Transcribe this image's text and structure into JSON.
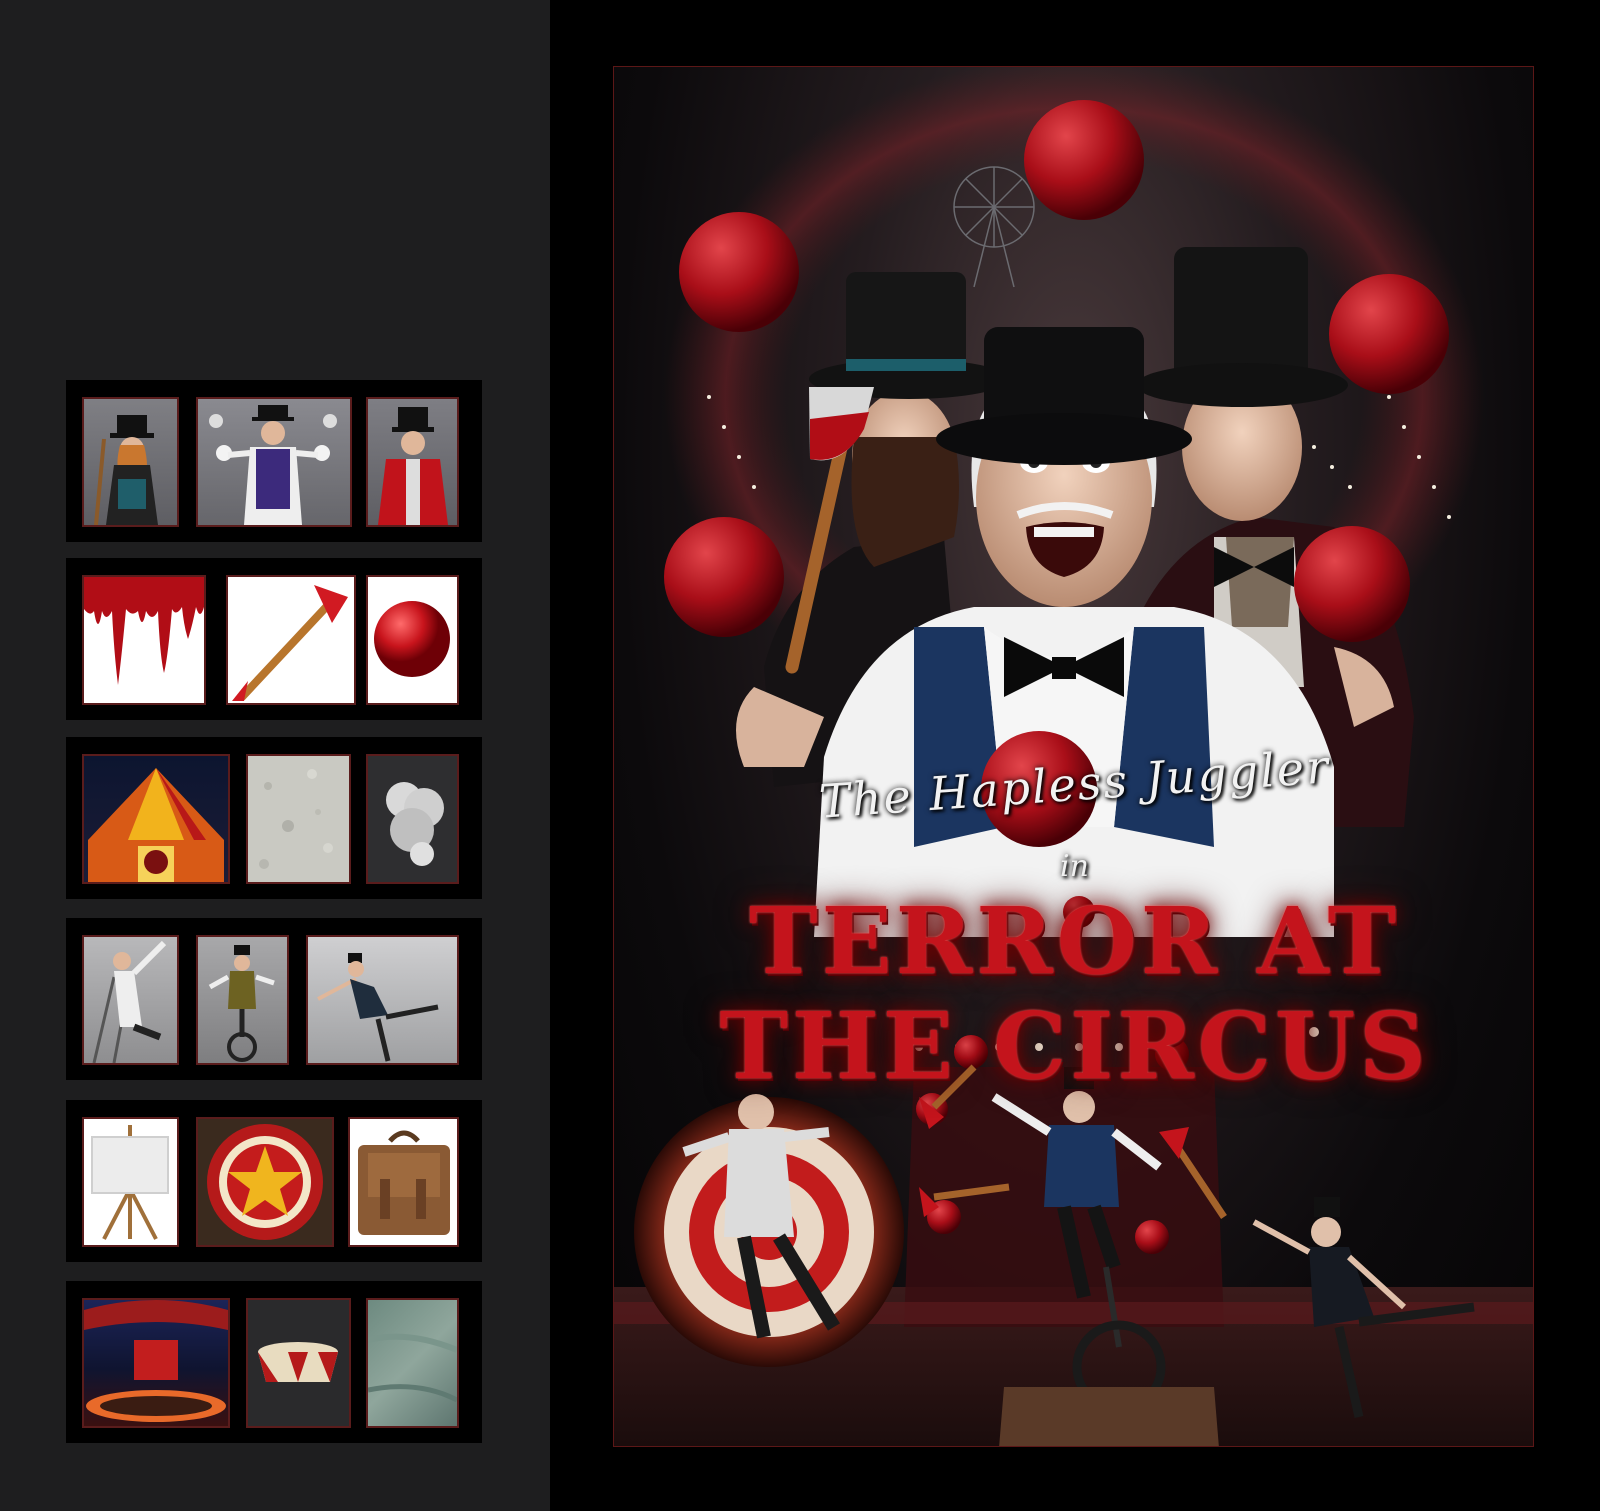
{
  "colors": {
    "panel_bg": "#1e1e1f",
    "strip_bg": "#000000",
    "thumb_border": "#5a1c1c",
    "poster_border": "#5c1717",
    "ball_red": "#b3121d",
    "title_red": "#c4141c"
  },
  "source_strips": [
    {
      "row": 1,
      "thumbs": [
        {
          "name": "thumb-woman-top-hat-axe",
          "icon": "woman-performer-icon"
        },
        {
          "name": "thumb-juggler-studio",
          "icon": "juggler-icon"
        },
        {
          "name": "thumb-ringmaster-red-coat",
          "icon": "ringmaster-icon"
        }
      ]
    },
    {
      "row": 2,
      "thumbs": [
        {
          "name": "thumb-dripping-blood",
          "icon": "blood-drip-icon"
        },
        {
          "name": "thumb-fire-axe",
          "icon": "axe-icon"
        },
        {
          "name": "thumb-red-ball",
          "icon": "red-ball-icon"
        }
      ]
    },
    {
      "row": 3,
      "thumbs": [
        {
          "name": "thumb-circus-tent-night",
          "icon": "circus-tent-icon"
        },
        {
          "name": "thumb-plaster-texture",
          "icon": "texture-icon"
        },
        {
          "name": "thumb-smoke-cloud",
          "icon": "cloud-icon"
        }
      ]
    },
    {
      "row": 4,
      "thumbs": [
        {
          "name": "thumb-man-on-ladder",
          "icon": "ladder-pose-icon"
        },
        {
          "name": "thumb-unicycle-rider",
          "icon": "unicycle-icon"
        },
        {
          "name": "thumb-dancer-leaning",
          "icon": "dancer-icon"
        }
      ]
    },
    {
      "row": 5,
      "thumbs": [
        {
          "name": "thumb-canvas-easel",
          "icon": "easel-icon"
        },
        {
          "name": "thumb-star-target-wheel",
          "icon": "target-wheel-icon"
        },
        {
          "name": "thumb-leather-satchel",
          "icon": "satchel-icon"
        }
      ]
    },
    {
      "row": 6,
      "thumbs": [
        {
          "name": "thumb-circus-ring-interior",
          "icon": "circus-ring-icon"
        },
        {
          "name": "thumb-circus-drum-pedestal",
          "icon": "pedestal-icon"
        },
        {
          "name": "thumb-green-texture",
          "icon": "texture-icon"
        }
      ]
    }
  ],
  "poster": {
    "tagline": "The Hapless Juggler",
    "tagline_connector": "in",
    "title_line_1": "TERROR AT",
    "title_line_2": "THE CIRCUS"
  }
}
